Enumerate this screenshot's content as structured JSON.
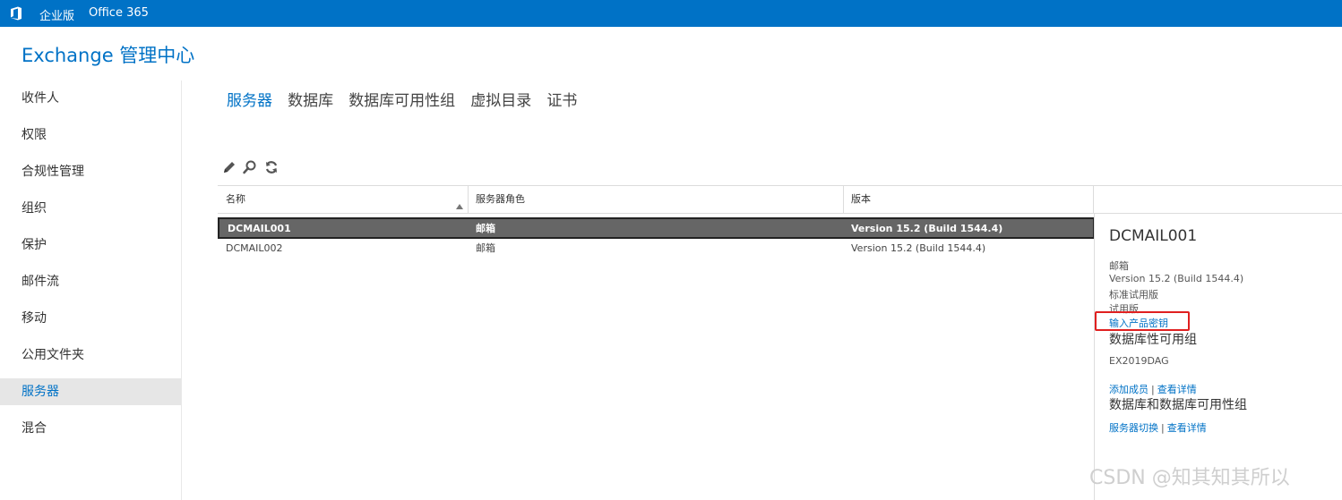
{
  "topbar": {
    "logo_icon": "office-logo-icon",
    "active_label": "企业版",
    "office_label": "Office 365",
    "color": "#0072c6"
  },
  "app": {
    "title": "Exchange 管理中心"
  },
  "sidebar": {
    "items": [
      {
        "label": "收件人"
      },
      {
        "label": "权限"
      },
      {
        "label": "合规性管理"
      },
      {
        "label": "组织"
      },
      {
        "label": "保护"
      },
      {
        "label": "邮件流"
      },
      {
        "label": "移动"
      },
      {
        "label": "公用文件夹"
      },
      {
        "label": "服务器",
        "active": true
      },
      {
        "label": "混合"
      }
    ]
  },
  "tabs": [
    {
      "label": "服务器",
      "active": true
    },
    {
      "label": "数据库"
    },
    {
      "label": "数据库可用性组"
    },
    {
      "label": "虚拟目录"
    },
    {
      "label": "证书"
    }
  ],
  "toolbar": {
    "icons": [
      "edit-pencil-icon",
      "search-icon",
      "refresh-icon"
    ]
  },
  "grid": {
    "columns": [
      "名称",
      "服务器角色",
      "版本"
    ],
    "sort_icon": "sort-ascending-icon",
    "rows": [
      {
        "name": "DCMAIL001",
        "role": "邮箱",
        "version": "Version 15.2 (Build 1544.4)",
        "selected": true
      },
      {
        "name": "DCMAIL002",
        "role": "邮箱",
        "version": "Version 15.2 (Build 1544.4)",
        "selected": false
      }
    ]
  },
  "details": {
    "title": "DCMAIL001",
    "role": "邮箱",
    "version": "Version 15.2 (Build 1544.4)",
    "edition": "标准试用版",
    "trial": "试用版",
    "product_key_link": "输入产品密钥",
    "dag_heading": "数据库性可用组",
    "dag_name": "EX2019DAG",
    "add_member_link": "添加成员",
    "separator": "|",
    "view_details_link": "查看详情",
    "db_heading": "数据库和数据库可用性组",
    "switchover_link": "服务器切换",
    "view_details_link_2": "查看详情"
  },
  "watermark": "CSDN @知其知其所以"
}
